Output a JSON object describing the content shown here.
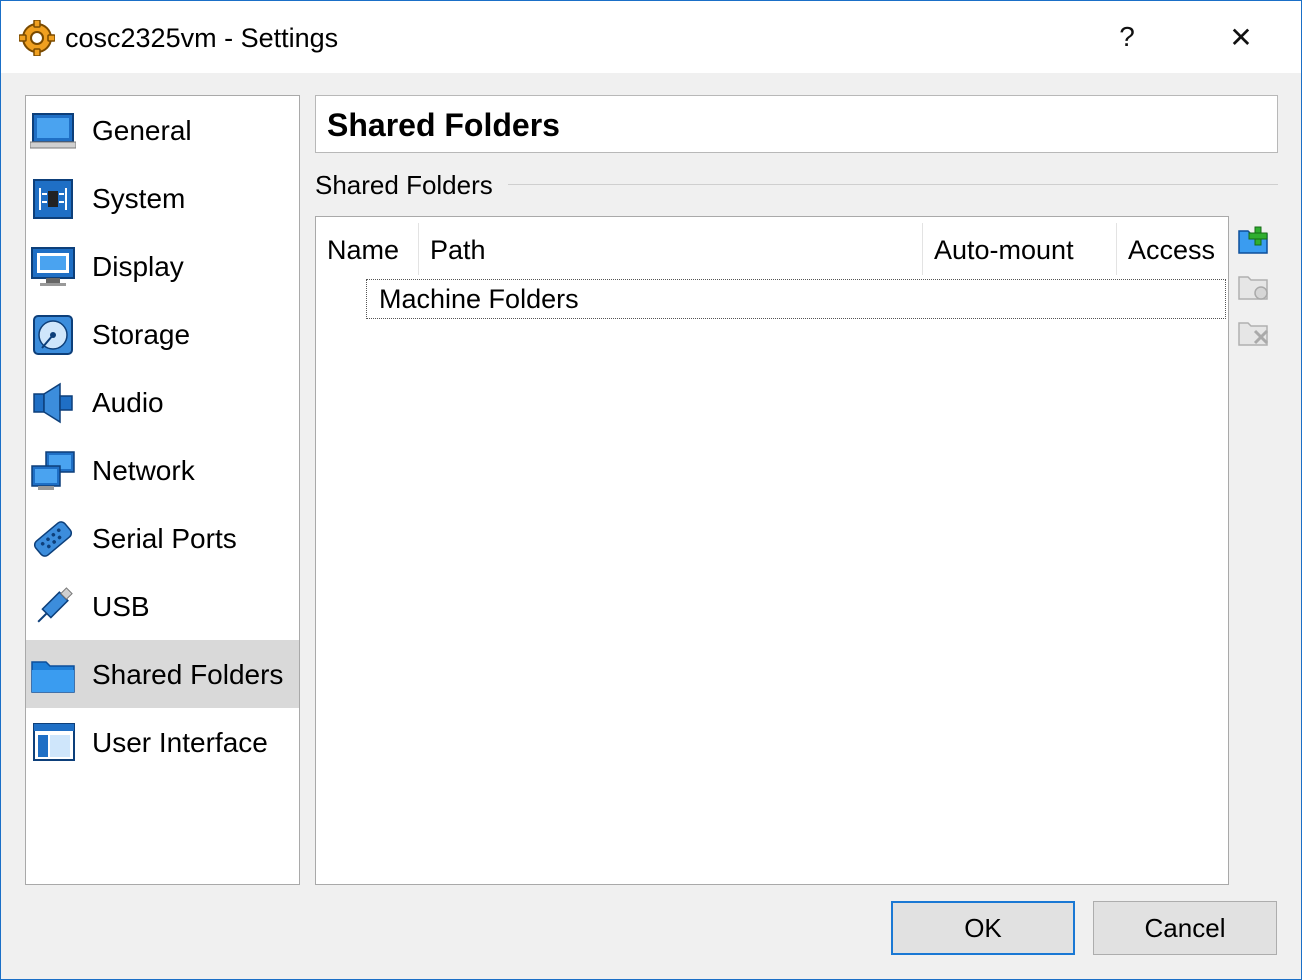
{
  "window": {
    "title": "cosc2325vm - Settings",
    "help_label": "?",
    "close_label": "✕"
  },
  "sidebar": {
    "items": [
      {
        "label": "General",
        "icon": "general-icon"
      },
      {
        "label": "System",
        "icon": "system-icon"
      },
      {
        "label": "Display",
        "icon": "display-icon"
      },
      {
        "label": "Storage",
        "icon": "storage-icon"
      },
      {
        "label": "Audio",
        "icon": "audio-icon"
      },
      {
        "label": "Network",
        "icon": "network-icon"
      },
      {
        "label": "Serial Ports",
        "icon": "serial-ports-icon"
      },
      {
        "label": "USB",
        "icon": "usb-icon"
      },
      {
        "label": "Shared Folders",
        "icon": "shared-folders-icon",
        "selected": true
      },
      {
        "label": "User Interface",
        "icon": "user-interface-icon"
      }
    ]
  },
  "page": {
    "title": "Shared Folders",
    "group_label": "Shared Folders"
  },
  "table": {
    "columns": [
      "Name",
      "Path",
      "Auto-mount",
      "Access"
    ],
    "rows": [
      {
        "label": "Machine Folders"
      }
    ]
  },
  "tools": {
    "add_icon": "add-folder-icon",
    "edit_icon": "edit-folder-icon",
    "remove_icon": "remove-folder-icon"
  },
  "buttons": {
    "ok_label": "OK",
    "cancel_label": "Cancel"
  },
  "colors": {
    "accent": "#1a78d4",
    "selection": "#d9d9d9",
    "border": "#a9a9a9"
  }
}
